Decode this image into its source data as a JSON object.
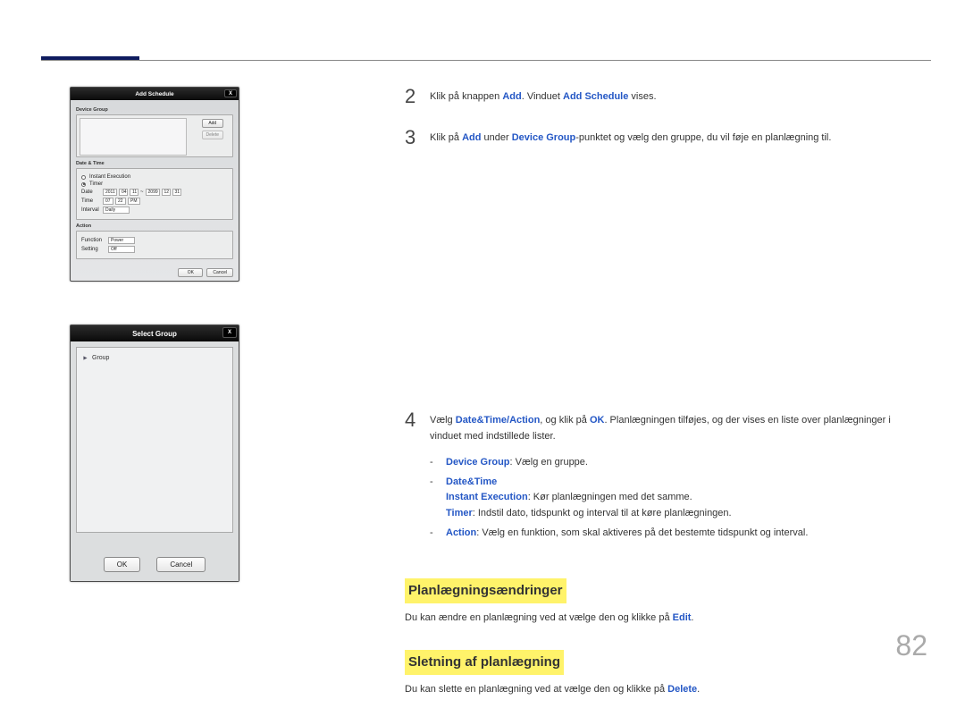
{
  "page_number": "82",
  "dialog1": {
    "title": "Add Schedule",
    "close_glyph": "X",
    "section_device_group": "Device Group",
    "btn_add": "Add",
    "btn_delete": "Delete",
    "section_datetime": "Date & Time",
    "radio_instant": "Instant Execution",
    "radio_timer": "Timer",
    "row_date_label": "Date",
    "date_vals": [
      "2011",
      "04",
      "11",
      "2099",
      "12",
      "31"
    ],
    "row_time_label": "Time",
    "time_vals": [
      "07",
      "22",
      "PM"
    ],
    "row_interval_label": "Interval",
    "interval_val": "Daily",
    "section_action": "Action",
    "row_function_label": "Function",
    "function_val": "Power",
    "row_setting_label": "Setting",
    "setting_val": "Off",
    "btn_ok": "OK",
    "btn_cancel": "Cancel"
  },
  "dialog2": {
    "title": "Select Group",
    "close_glyph": "X",
    "item_label": "Group",
    "btn_ok": "OK",
    "btn_cancel": "Cancel"
  },
  "step2": {
    "num": "2",
    "t1": "Klik på knappen ",
    "kw1": "Add",
    "t2": ". Vinduet ",
    "kw2": "Add Schedule",
    "t3": " vises."
  },
  "step3": {
    "num": "3",
    "t1": "Klik på ",
    "kw1": "Add",
    "t2": " under ",
    "kw2": "Device Group",
    "t3": "-punktet og vælg den gruppe, du vil føje en planlægning til."
  },
  "step4": {
    "num": "4",
    "t1": "Vælg ",
    "kw1": "Date&Time/Action",
    "t2": ", og klik på ",
    "kw2": "OK",
    "t3": ". Planlægningen tilføjes, og der vises en liste over planlægninger i vinduet med indstillede lister.",
    "sub_dg_kw": "Device Group",
    "sub_dg_rest": ": Vælg en gruppe.",
    "sub_dt_kw": "Date&Time",
    "sub_ie_kw": "Instant Execution",
    "sub_ie_rest": ": Kør planlægningen med det samme.",
    "sub_timer_kw": "Timer",
    "sub_timer_rest": ": Indstil dato, tidspunkt og interval til at køre planlægningen.",
    "sub_action_kw": "Action",
    "sub_action_rest": ": Vælg en funktion, som skal aktiveres på det bestemte tidspunkt og interval."
  },
  "section_changes": {
    "heading": "Planlægningsændringer",
    "t1": "Du kan ændre en planlægning ved at vælge den og klikke på ",
    "kw": "Edit",
    "t2": "."
  },
  "section_delete": {
    "heading": "Sletning af planlægning",
    "t1": "Du kan slette en planlægning ved at vælge den og klikke på ",
    "kw": "Delete",
    "t2": "."
  }
}
